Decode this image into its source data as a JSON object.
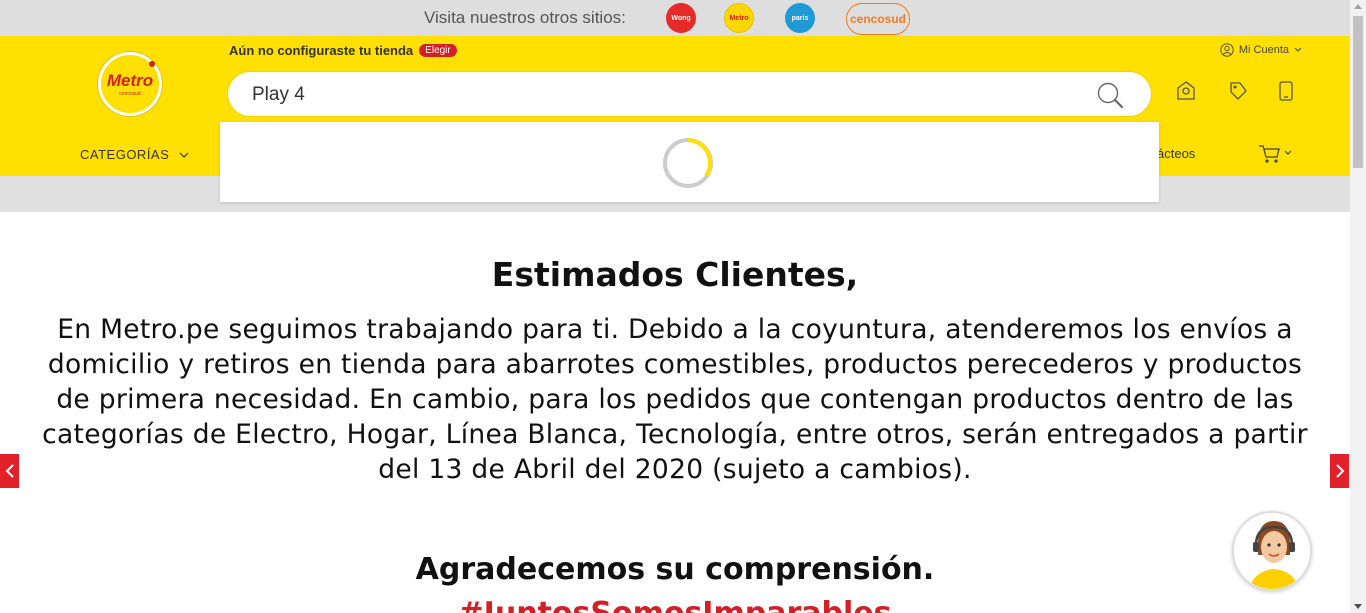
{
  "topbar": {
    "label": "Visita nuestros otros sitios:",
    "sites": [
      {
        "name": "Wong",
        "color": "#e52a2a"
      },
      {
        "name": "Metro",
        "color": "#ffd600"
      },
      {
        "name": "paris",
        "color": "#1f9ad6"
      },
      {
        "name": "cencosud",
        "color": "#f07b20"
      }
    ]
  },
  "header": {
    "logo_text": "Metro",
    "logo_sub": "cencosud",
    "store_note": "Aún no configuraste tu tienda",
    "store_button": "Elegir",
    "account_label": "Mi Cuenta",
    "brand_yellow": "#ffe000",
    "brand_red": "#d41f26"
  },
  "search": {
    "value": "Play 4",
    "placeholder": ""
  },
  "nav": {
    "categories_label": "CATEGORÍAS",
    "partial_item": "ácteos"
  },
  "content": {
    "title": "Estimados Clientes,",
    "body": "En Metro.pe seguimos trabajando para ti. Debido a la coyuntura, atenderemos los envíos a domicilio y retiros en tienda para abarrotes comestibles, productos perecederos y productos de primera necesidad. En cambio, para los pedidos que contengan productos dentro de las categorías de Electro, Hogar, Línea Blanca, Tecnología, entre otros, serán entregados a partir del 13 de Abril del 2020 (sujeto a cambios).",
    "thanks": "Agradecemos su comprensión.",
    "hashtag": "#JuntosSomosImparables"
  },
  "icons": {
    "search": "search-icon",
    "account": "user-icon",
    "cart": "cart-icon",
    "slider_prev": "chevron-left-icon",
    "slider_next": "chevron-right-icon"
  }
}
